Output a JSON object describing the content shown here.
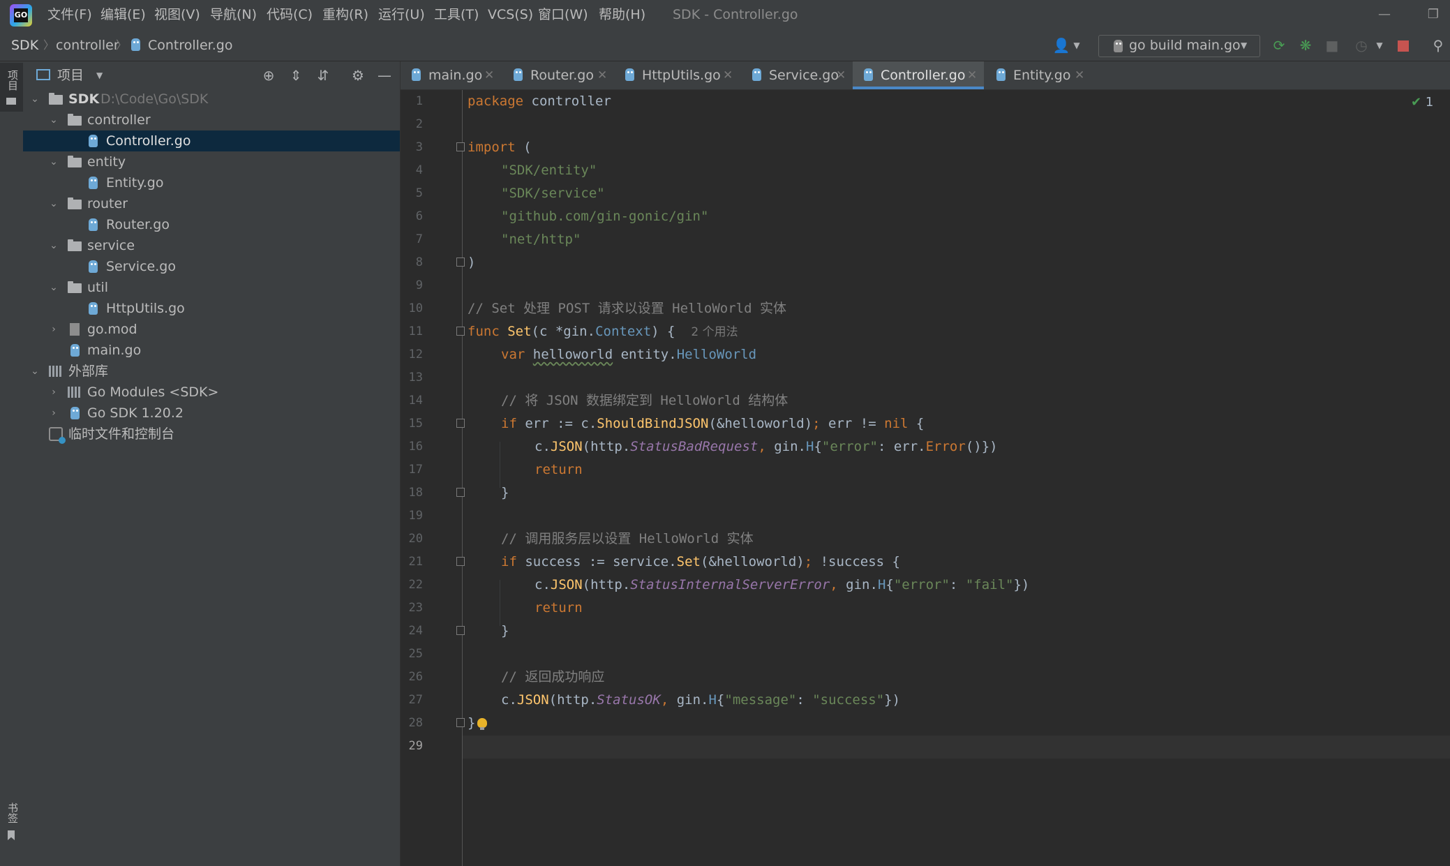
{
  "menu": {
    "items": [
      "文件(F)",
      "编辑(E)",
      "视图(V)",
      "导航(N)",
      "代码(C)",
      "重构(R)",
      "运行(U)",
      "工具(T)",
      "VCS(S)",
      "窗口(W)",
      "帮助(H)"
    ],
    "window_title": "SDK - Controller.go",
    "logo_text": "GO"
  },
  "nav": {
    "breadcrumbs": [
      "SDK",
      "controller",
      "Controller.go"
    ],
    "run_config": "go build main.go"
  },
  "left_strip": {
    "project_label": "项目",
    "bookmarks_label": "书签"
  },
  "project": {
    "title": "项目",
    "tree": [
      {
        "label": "SDK",
        "path": "D:\\Code\\Go\\SDK"
      },
      {
        "label": "controller"
      },
      {
        "label": "Controller.go"
      },
      {
        "label": "entity"
      },
      {
        "label": "Entity.go"
      },
      {
        "label": "router"
      },
      {
        "label": "Router.go"
      },
      {
        "label": "service"
      },
      {
        "label": "Service.go"
      },
      {
        "label": "util"
      },
      {
        "label": "HttpUtils.go"
      },
      {
        "label": "go.mod"
      },
      {
        "label": "main.go"
      },
      {
        "label": "外部库"
      },
      {
        "label": "Go Modules <SDK>"
      },
      {
        "label": "Go SDK 1.20.2"
      },
      {
        "label": "临时文件和控制台"
      }
    ]
  },
  "tabs": [
    "main.go",
    "Router.go",
    "HttpUtils.go",
    "Service.go",
    "Controller.go",
    "Entity.go"
  ],
  "active_tab": "Controller.go",
  "editor": {
    "inspection_count": "1",
    "line_numbers": [
      "1",
      "2",
      "3",
      "4",
      "5",
      "6",
      "7",
      "8",
      "9",
      "10",
      "11",
      "12",
      "13",
      "14",
      "15",
      "16",
      "17",
      "18",
      "19",
      "20",
      "21",
      "22",
      "23",
      "24",
      "25",
      "26",
      "27",
      "28",
      "29"
    ],
    "usage_hint": "2 个用法",
    "code": {
      "l1_kw": "package",
      "l1_name": " controller",
      "l3_kw": "import",
      "l3_rest": " (",
      "l4": "\"SDK/entity\"",
      "l5": "\"SDK/service\"",
      "l6": "\"github.com/gin-gonic/gin\"",
      "l7": "\"net/http\"",
      "l8": ")",
      "l10": "// Set 处理 POST 请求以设置 HelloWorld 实体",
      "l11_kw": "func",
      "l11_fn": "Set",
      "l11_a": "(c *gin.",
      "l11_t": "Context",
      "l11_b": ") {",
      "l12_kw": "var",
      "l12_var": "helloworld",
      "l12_a": " entity.",
      "l12_t": "HelloWorld",
      "l14": "// 将 JSON 数据绑定到 HelloWorld 结构体",
      "l15_kw1": "if",
      "l15_a": " err := c.",
      "l15_fn": "ShouldBindJSON",
      "l15_b": "(&helloworld)",
      "l15_semi": ";",
      "l15_c": " err != ",
      "l15_kw2": "nil",
      "l15_d": " {",
      "l16_a": "c.",
      "l16_fn": "JSON",
      "l16_b": "(http.",
      "l16_c": "StatusBadRequest",
      "l16_comma": ",",
      "l16_d": " gin.",
      "l16_t": "H",
      "l16_e": "{",
      "l16_s": "\"error\"",
      "l16_f": ": err.",
      "l16_fn2": "Error",
      "l16_g": "()})",
      "l17": "return",
      "l18": "}",
      "l20": "// 调用服务层以设置 HelloWorld 实体",
      "l21_kw": "if",
      "l21_a": " success := service.",
      "l21_fn": "Set",
      "l21_b": "(&helloworld)",
      "l21_semi": ";",
      "l21_c": " !success {",
      "l22_a": "c.",
      "l22_fn": "JSON",
      "l22_b": "(http.",
      "l22_c": "StatusInternalServerError",
      "l22_comma": ",",
      "l22_d": " gin.",
      "l22_t": "H",
      "l22_e": "{",
      "l22_s1": "\"error\"",
      "l22_f": ": ",
      "l22_s2": "\"fail\"",
      "l22_g": "})",
      "l23": "return",
      "l24": "}",
      "l26": "// 返回成功响应",
      "l27_a": "c.",
      "l27_fn": "JSON",
      "l27_b": "(http.",
      "l27_c": "StatusOK",
      "l27_comma": ",",
      "l27_d": " gin.",
      "l27_t": "H",
      "l27_e": "{",
      "l27_s1": "\"message\"",
      "l27_f": ": ",
      "l27_s2": "\"success\"",
      "l27_g": "})",
      "l28": "}"
    }
  },
  "colors": {
    "keyword": "#cc7832",
    "string": "#6a8759",
    "comment": "#808080",
    "function": "#ffc66d",
    "accent": "#4a88c7",
    "selection": "#0d293e"
  }
}
